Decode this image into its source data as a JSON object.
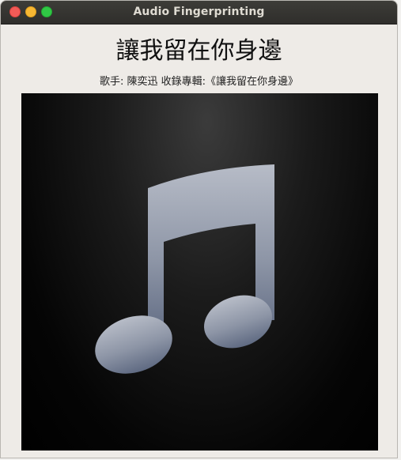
{
  "window": {
    "title": "Audio Fingerprinting"
  },
  "song": {
    "title": "讓我留在你身邊",
    "info": "歌手: 陳奕迅  收錄專輯:《讓我留在你身邊》"
  },
  "colors": {
    "titlebar": "#2f2e2b",
    "close": "#f25b57",
    "minimize": "#f7b733",
    "maximize": "#30c845",
    "window_bg": "#eeebe7"
  },
  "icons": {
    "album_art": "music-note-icon"
  }
}
